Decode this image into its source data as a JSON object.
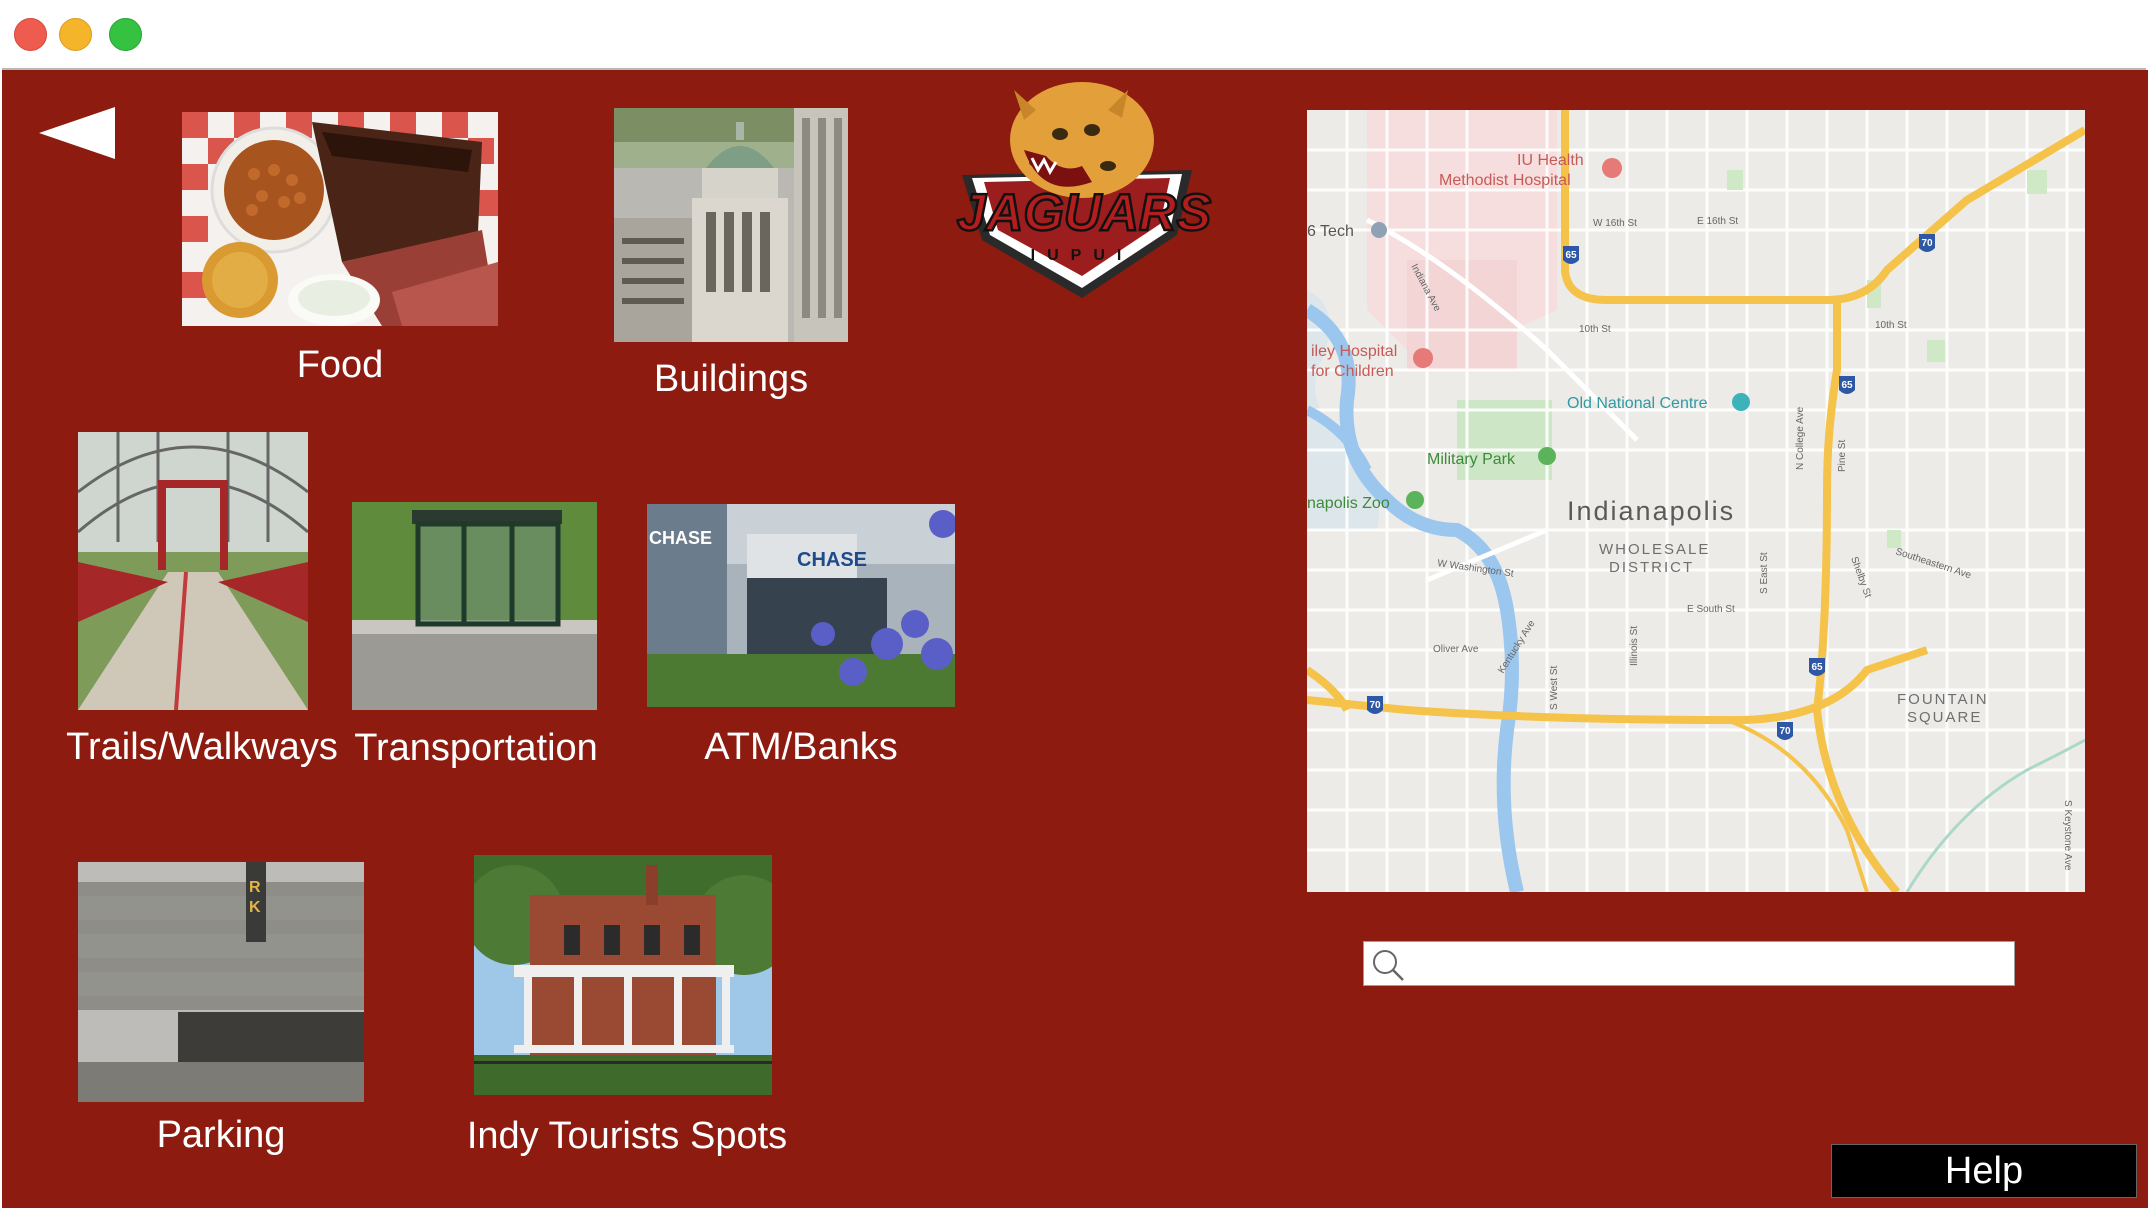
{
  "window": {
    "controls": [
      "close",
      "minimize",
      "maximize"
    ]
  },
  "nav": {
    "back_icon": "back-arrow-icon"
  },
  "categories": [
    {
      "id": "food",
      "label": "Food"
    },
    {
      "id": "buildings",
      "label": "Buildings"
    },
    {
      "id": "trails",
      "label": "Trails/Walkways"
    },
    {
      "id": "transportation",
      "label": "Transportation"
    },
    {
      "id": "atm",
      "label": "ATM/Banks"
    },
    {
      "id": "parking",
      "label": "Parking"
    },
    {
      "id": "tourist",
      "label": "Indy Tourists Spots"
    }
  ],
  "logo": {
    "text": "JAGUARS",
    "subtext": "IUPUI"
  },
  "map": {
    "city": "Indianapolis",
    "districts": [
      "WHOLESALE",
      "DISTRICT",
      "FOUNTAIN",
      "SQUARE"
    ],
    "places": [
      "IU Health",
      "Methodist Hospital",
      "6 Tech",
      "iley Hospital",
      "for Children",
      "Old National Centre",
      "Military Park",
      "napolis Zoo"
    ],
    "streets": [
      "W 16th St",
      "E 16th St",
      "10th St",
      "10th St",
      "W Washington St",
      "E South St",
      "Oliver Ave",
      "Kentucky Ave",
      "S West St",
      "Illinois St",
      "S East St",
      "N College Ave",
      "Pine St",
      "Shelby St",
      "Southeastern Ave",
      "Indiana Ave",
      "S Keystone Ave"
    ],
    "shields": [
      "65",
      "70",
      "65",
      "70",
      "70",
      "65"
    ]
  },
  "search": {
    "placeholder": "",
    "value": ""
  },
  "help": {
    "label": "Help"
  },
  "colors": {
    "background": "#8d1b0f",
    "label": "#ffffff",
    "help_bg": "#000000"
  }
}
